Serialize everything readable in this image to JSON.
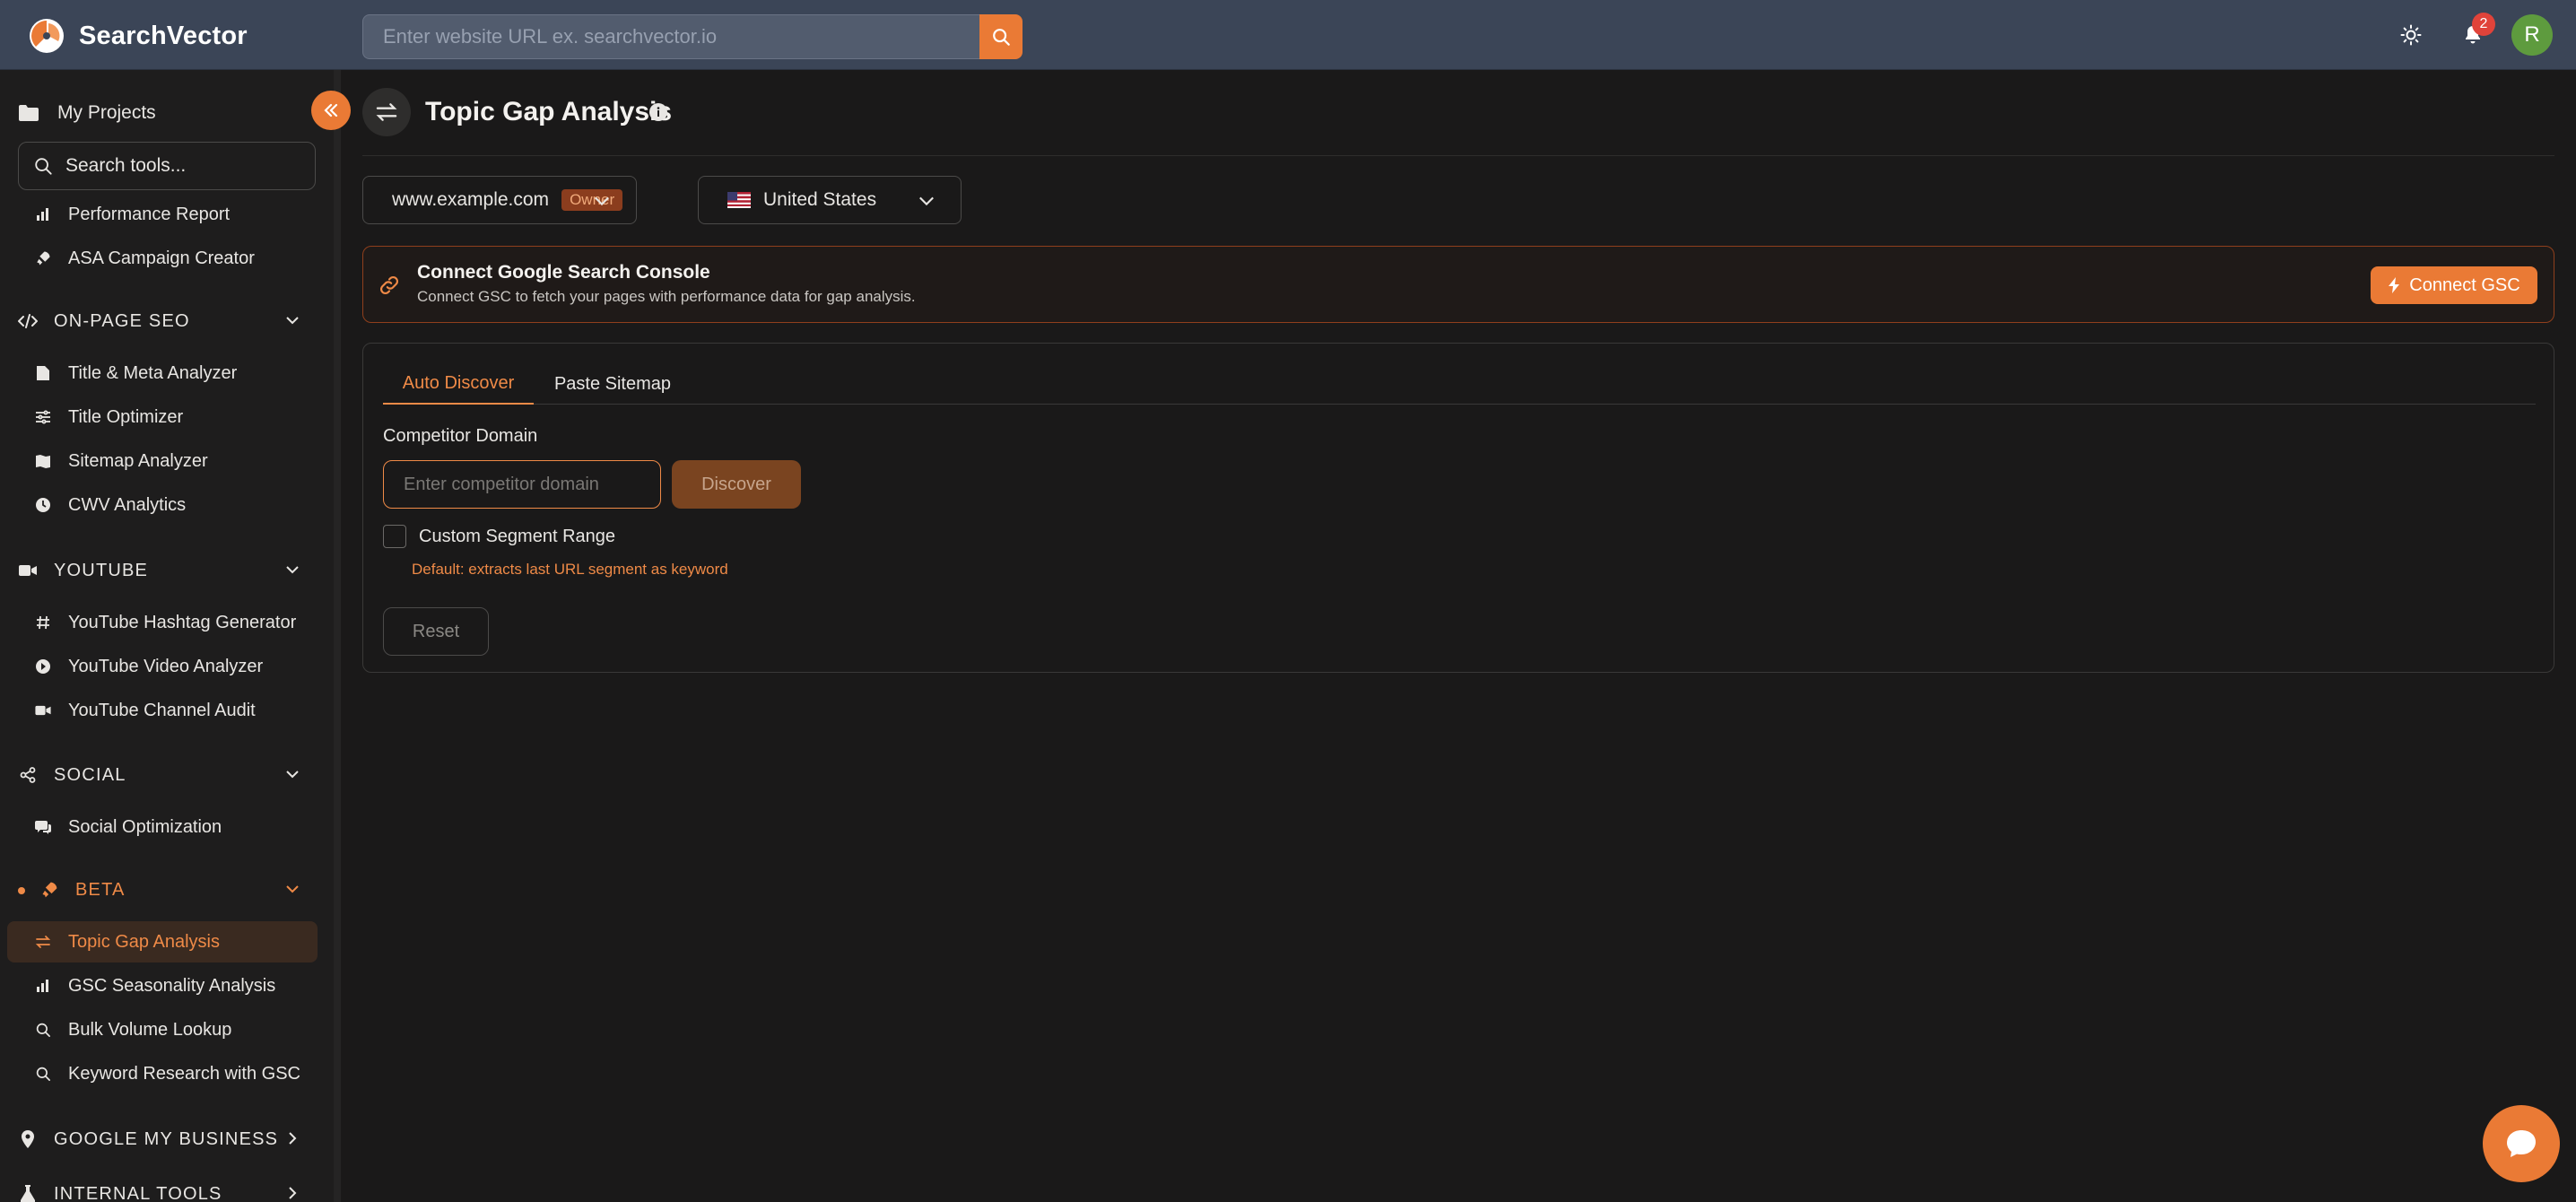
{
  "app": {
    "name": "SearchVector"
  },
  "topbar": {
    "url_placeholder": "Enter website URL ex. searchvector.io",
    "notification_count": "2",
    "avatar_initial": "R"
  },
  "sidebar": {
    "my_projects": "My Projects",
    "search_placeholder": "Search tools...",
    "items_top": [
      {
        "label": "Performance Report",
        "icon": "bar-chart-icon"
      },
      {
        "label": "ASA Campaign Creator",
        "icon": "rocket-icon"
      }
    ],
    "sections": {
      "onpage": {
        "label": "ON-PAGE SEO",
        "icon": "code-icon"
      },
      "youtube": {
        "label": "YOUTUBE",
        "icon": "video-icon"
      },
      "social": {
        "label": "SOCIAL",
        "icon": "share-icon"
      },
      "beta": {
        "label": "BETA",
        "icon": "rocket-icon"
      },
      "gmb": {
        "label": "GOOGLE MY BUSINESS",
        "icon": "map-pin-icon"
      },
      "internal": {
        "label": "INTERNAL TOOLS",
        "icon": "flask-icon"
      }
    },
    "onpage_items": [
      "Title & Meta Analyzer",
      "Title Optimizer",
      "Sitemap Analyzer",
      "CWV Analytics"
    ],
    "youtube_items": [
      "YouTube Hashtag Generator",
      "YouTube Video Analyzer",
      "YouTube Channel Audit"
    ],
    "social_items": [
      "Social Optimization"
    ],
    "beta_items": [
      "Topic Gap Analysis",
      "GSC Seasonality Analysis",
      "Bulk Volume Lookup",
      "Keyword Research with GSC"
    ]
  },
  "page": {
    "title": "Topic Gap Analysis",
    "site_select": {
      "value": "www.example.com",
      "badge": "Owner"
    },
    "country_select": {
      "value": "United States"
    },
    "gsc_banner": {
      "title": "Connect Google Search Console",
      "subtitle": "Connect GSC to fetch your pages with performance data for gap analysis.",
      "button": "Connect GSC"
    },
    "tabs": [
      "Auto Discover",
      "Paste Sitemap"
    ],
    "competitor_label": "Competitor Domain",
    "competitor_placeholder": "Enter competitor domain",
    "discover_button": "Discover",
    "custom_segment_label": "Custom Segment Range",
    "custom_segment_checked": false,
    "hint": "Default: extracts last URL segment as keyword",
    "reset_button": "Reset"
  },
  "colors": {
    "accent": "#ea7a35",
    "topbar": "#3b4557",
    "background": "#1a1919"
  }
}
